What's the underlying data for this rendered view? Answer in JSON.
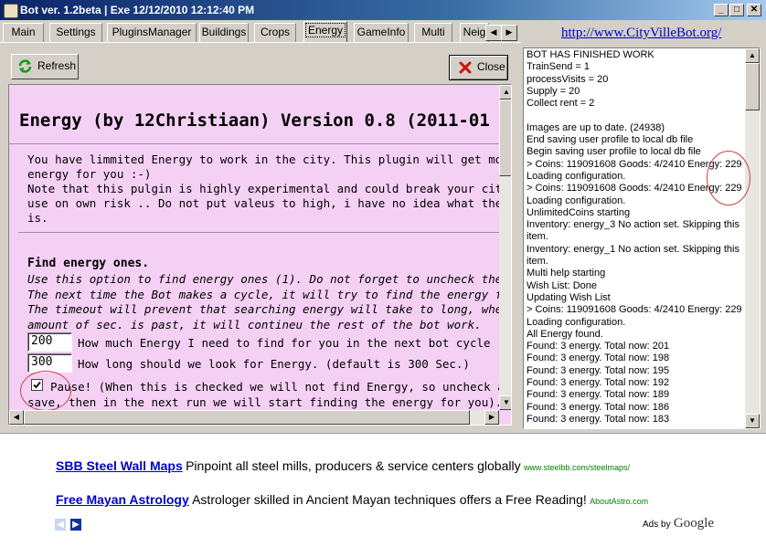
{
  "window": {
    "title": "Bot ver. 1.2beta | Exe 12/12/2010 12:12:40 PM",
    "min": "_",
    "max": "□",
    "close": "✕"
  },
  "tabs": [
    "Main",
    "Settings",
    "PluginsManager",
    "Buildings",
    "Crops",
    "Energy",
    "GameInfo",
    "Multi",
    "Neig"
  ],
  "active_tab": "Energy",
  "toolbar": {
    "refresh": "Refresh",
    "close": "Close"
  },
  "site_link": "http://www.CityVilleBot.org/",
  "plugin": {
    "title": "Energy (by 12Christiaan) Version 0.8 (2011-01",
    "intro": [
      "You have limmited Energy to work in the city. This plugin will get more",
      "energy for you :-)",
      "Note that this pulgin is highly experimental and could break your city.",
      "use on own risk .. Do not put valeus to high, i have no idea what the limmit",
      "is."
    ],
    "section_title": "Find energy ones.",
    "section_desc": [
      "Use this option to find energy ones (1). Do not forget to uncheck the pause.",
      "The next time the Bot makes a cycle, it will try to find the energy for you.",
      "The timeout will prevent that searching energy will take to long, when the",
      "amount of sec. is past, it will contineu the rest of the bot work."
    ],
    "energy_value": "200",
    "energy_label": "How much Energy I need to find for you in the next bot cycle",
    "timeout_value": "300",
    "timeout_label": "How long should we look for Energy. (default is 300 Sec.)",
    "pause_label_1": "Pause! (When this is checked we will not find Energy, so uncheck and",
    "pause_label_2": "save, then in the next run we will start finding the energy for you)."
  },
  "log": [
    "BOT HAS FINISHED WORK",
    "TrainSend = 1",
    "processVisits = 20",
    "Supply = 20",
    "Collect rent = 2",
    "",
    "Images are up to date. (24938)",
    "End saving user profile to local db file",
    "Begin saving user profile to local db file",
    "> Coins: 119091608 Goods: 4/2410 Energy: 229",
    "Loading configuration.",
    "> Coins: 119091608 Goods: 4/2410 Energy: 229",
    "Loading configuration.",
    "UnlimitedCoins starting",
    "Inventory: energy_3 No action set. Skipping this",
    "item.",
    "Inventory: energy_1 No action set. Skipping this",
    "item.",
    "Multi help starting",
    "Wish List: Done",
    "Updating Wish List",
    "> Coins: 119091608 Goods: 4/2410 Energy: 229",
    "Loading configuration.",
    "All Energy found.",
    "Found: 3 energy. Total now: 201",
    "Found: 3 energy. Total now: 198",
    "Found: 3 energy. Total now: 195",
    "Found: 3 energy. Total now: 192",
    "Found: 3 energy. Total now: 189",
    "Found: 3 energy. Total now: 186",
    "Found: 3 energy. Total now: 183"
  ],
  "ads": [
    {
      "link": "SBB Steel Wall Maps",
      "text": "Pinpoint all steel mills, producers & service centers globally",
      "url": "www.steelbb.com/steelmaps/"
    },
    {
      "link": "Free Mayan Astrology",
      "text": "Astrologer skilled in Ancient Mayan techniques offers a Free Reading!",
      "url": "AboutAstro.com"
    }
  ],
  "ads_by": "Ads by",
  "google": "Google",
  "colors": {
    "title_bar": "#0a246a",
    "plugin_bg": "#f5d0f5",
    "link": "#0000cc",
    "ad_url": "#008000",
    "annotation": "#d04040"
  }
}
